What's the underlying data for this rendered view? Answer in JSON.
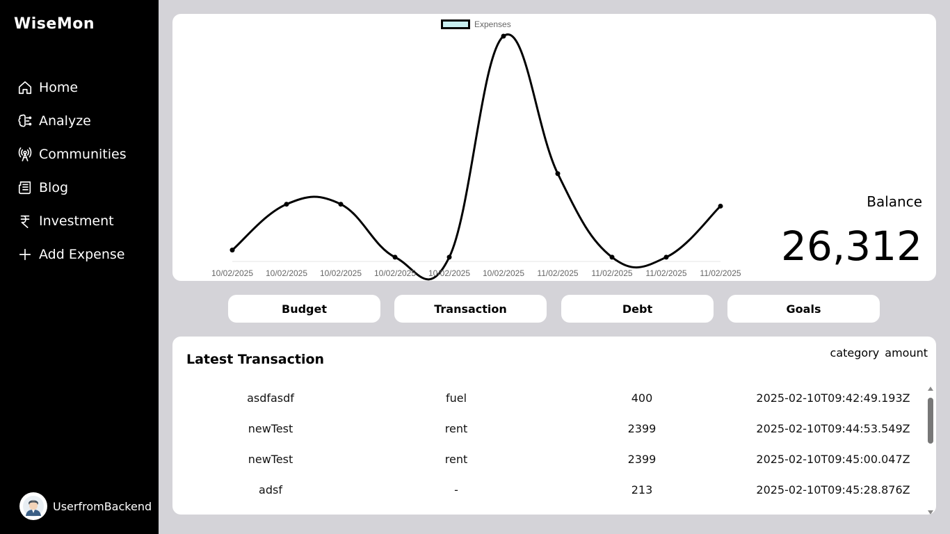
{
  "app": {
    "title": "WiseMon"
  },
  "sidebar": {
    "items": [
      {
        "label": "Home",
        "icon": "home-icon"
      },
      {
        "label": "Analyze",
        "icon": "brain-icon"
      },
      {
        "label": "Communities",
        "icon": "antenna-icon"
      },
      {
        "label": "Blog",
        "icon": "news-icon"
      },
      {
        "label": "Investment",
        "icon": "rupee-icon"
      },
      {
        "label": "Add Expense",
        "icon": "plus-icon"
      }
    ],
    "user": {
      "name": "UserfromBackend",
      "icon": "user-avatar-icon"
    }
  },
  "chart_data": {
    "type": "line",
    "legend": "Expenses",
    "legend_position": "top",
    "curve": "smooth",
    "grid": false,
    "x": [
      "10/02/2025",
      "10/02/2025",
      "10/02/2025",
      "10/02/2025",
      "10/02/2025",
      "10/02/2025",
      "11/02/2025",
      "11/02/2025",
      "11/02/2025",
      "11/02/2025"
    ],
    "series": [
      {
        "name": "Expenses",
        "values": [
          400,
          1600,
          1600,
          213,
          213,
          6000,
          2400,
          213,
          213,
          1550
        ]
      }
    ],
    "ylim": [
      120,
      6000
    ],
    "colors": {
      "line": "#000000",
      "legend_fill": "#c8eef0"
    }
  },
  "balance": {
    "label": "Balance",
    "value": "26,312"
  },
  "tabs": [
    {
      "label": "Budget"
    },
    {
      "label": "Transaction"
    },
    {
      "label": "Debt"
    },
    {
      "label": "Goals"
    }
  ],
  "transactions": {
    "title": "Latest Transaction",
    "sort_options": [
      "category",
      "amount"
    ],
    "rows": [
      [
        "asdfasdf",
        "fuel",
        "400",
        "2025-02-10T09:42:49.193Z"
      ],
      [
        "newTest",
        "rent",
        "2399",
        "2025-02-10T09:44:53.549Z"
      ],
      [
        "newTest",
        "rent",
        "2399",
        "2025-02-10T09:45:00.047Z"
      ],
      [
        "adsf",
        "-",
        "213",
        "2025-02-10T09:45:28.876Z"
      ]
    ]
  }
}
